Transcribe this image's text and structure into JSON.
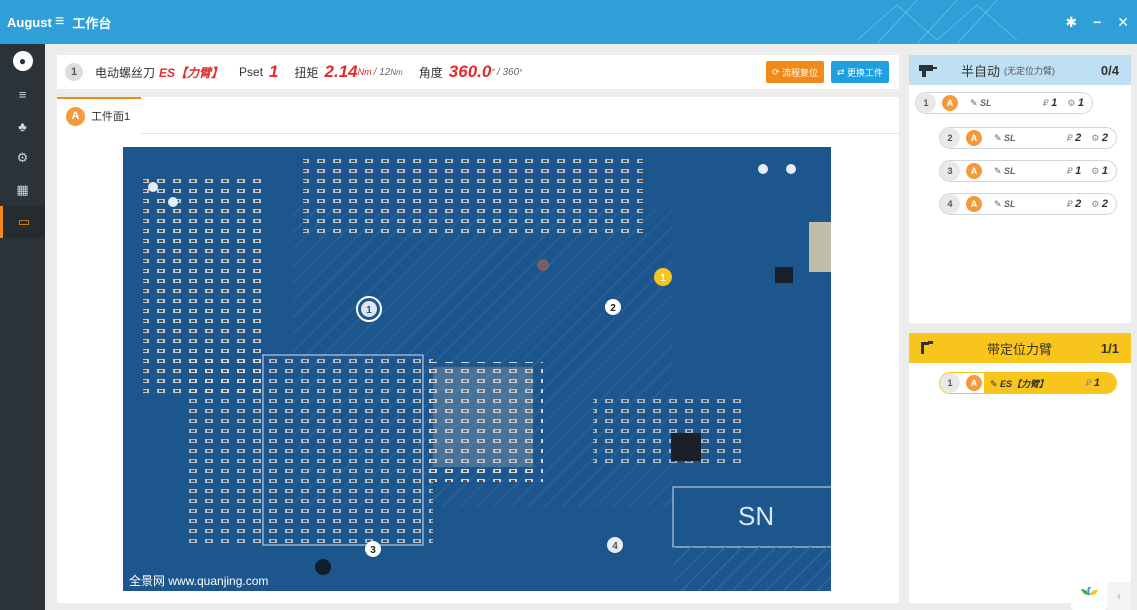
{
  "app": {
    "brand": "August",
    "menu_icon": "≡",
    "title": "工作台"
  },
  "window_controls": {
    "settings": "✱",
    "minimize": "−",
    "close": "✕"
  },
  "sidebar": {
    "items": [
      {
        "name": "user",
        "icon": "●"
      },
      {
        "name": "sliders",
        "icon": "≡"
      },
      {
        "name": "users",
        "icon": "♣"
      },
      {
        "name": "share",
        "icon": "⚙"
      },
      {
        "name": "grid",
        "icon": "▦"
      },
      {
        "name": "monitor",
        "icon": "▭"
      }
    ]
  },
  "header": {
    "step": "1",
    "tool_label": "电动螺丝刀",
    "tool_name": "ES【力臂】",
    "pset_label": "Pset",
    "pset_value": "1",
    "torque_label": "扭矩",
    "torque_value": "2.14",
    "torque_unit": "Nm",
    "torque_max": "/ 12",
    "torque_max_unit": "Nm",
    "angle_label": "角度",
    "angle_value": "360.0",
    "angle_unit": "°",
    "angle_max": "/ 360",
    "angle_max_unit": "°",
    "reset_button": "流程复位",
    "swap_button": "更换工件"
  },
  "workpiece": {
    "tab_letter": "A",
    "tab_label": "工件面1",
    "watermark": "全景网 www.quanjing.com",
    "markers": [
      {
        "label": "1",
        "style": "active"
      },
      {
        "label": "1",
        "style": "ring"
      },
      {
        "label": "2",
        "style": "ring"
      },
      {
        "label": "3",
        "style": "ring"
      },
      {
        "label": "4",
        "style": "ring"
      }
    ]
  },
  "semi_auto": {
    "title": "半自动",
    "subtitle": "(无定位力臂)",
    "count": "0/4",
    "rows": [
      {
        "num": "1",
        "letter": "A",
        "tool": "SL",
        "pset_icon": "₽",
        "pset": "1",
        "cnt_icon": "⚙",
        "cnt": "1"
      },
      {
        "num": "2",
        "letter": "A",
        "tool": "SL",
        "pset_icon": "₽",
        "pset": "2",
        "cnt_icon": "⚙",
        "cnt": "2"
      },
      {
        "num": "3",
        "letter": "A",
        "tool": "SL",
        "pset_icon": "₽",
        "pset": "1",
        "cnt_icon": "⚙",
        "cnt": "1"
      },
      {
        "num": "4",
        "letter": "A",
        "tool": "SL",
        "pset_icon": "₽",
        "pset": "2",
        "cnt_icon": "⚙",
        "cnt": "2"
      }
    ]
  },
  "positioned_arm": {
    "title": "带定位力臂",
    "count": "1/1",
    "rows": [
      {
        "num": "1",
        "letter": "A",
        "tool": "ES【力臂】",
        "pset_icon": "₽",
        "pset": "1"
      }
    ]
  },
  "colors": {
    "primary": "#2f9fd8",
    "accent": "#f08a1c",
    "red": "#e32b2b",
    "yellow": "#f7c51b",
    "sidebar": "#2b3338"
  }
}
